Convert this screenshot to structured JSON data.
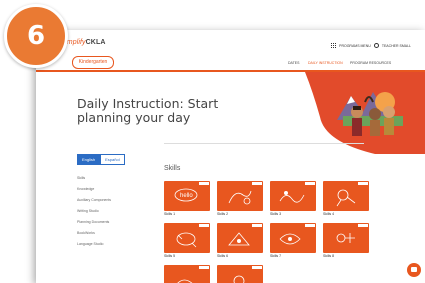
{
  "step_badge": "6",
  "header": {
    "brand_name": "Amplify",
    "brand_product": "CKLA",
    "grade": "Kindergarten",
    "programs_label": "PROGRAMS MENU",
    "teacher_label": "TEACHER SMALL"
  },
  "nav": {
    "items": [
      "DATES",
      "DAILY INSTRUCTION",
      "PROGRAM RESOURCES"
    ]
  },
  "hero": {
    "title": "Daily Instruction: Start planning your day"
  },
  "language": {
    "options": [
      "English",
      "Español"
    ],
    "selected": "English"
  },
  "sidebar": {
    "items": [
      "Skills",
      "Knowledge",
      "Auxiliary Components",
      "Writing Studio",
      "Planning Documents",
      "BookWorks",
      "Language Studio"
    ]
  },
  "main": {
    "section_title": "Skills",
    "cards": [
      {
        "label": "Skills 1"
      },
      {
        "label": "Skills 2"
      },
      {
        "label": "Skills 3"
      },
      {
        "label": "Skills 4"
      },
      {
        "label": "Skills 5"
      },
      {
        "label": "Skills 6"
      },
      {
        "label": "Skills 7"
      },
      {
        "label": "Skills 8"
      },
      {
        "label": ""
      },
      {
        "label": ""
      }
    ],
    "card_art_text": "hello"
  },
  "colors": {
    "accent": "#e8571f",
    "link": "#2b6cc4",
    "badge": "#ea7a33"
  },
  "icons": [
    "apps-grid-icon",
    "user-icon",
    "chat-icon"
  ]
}
